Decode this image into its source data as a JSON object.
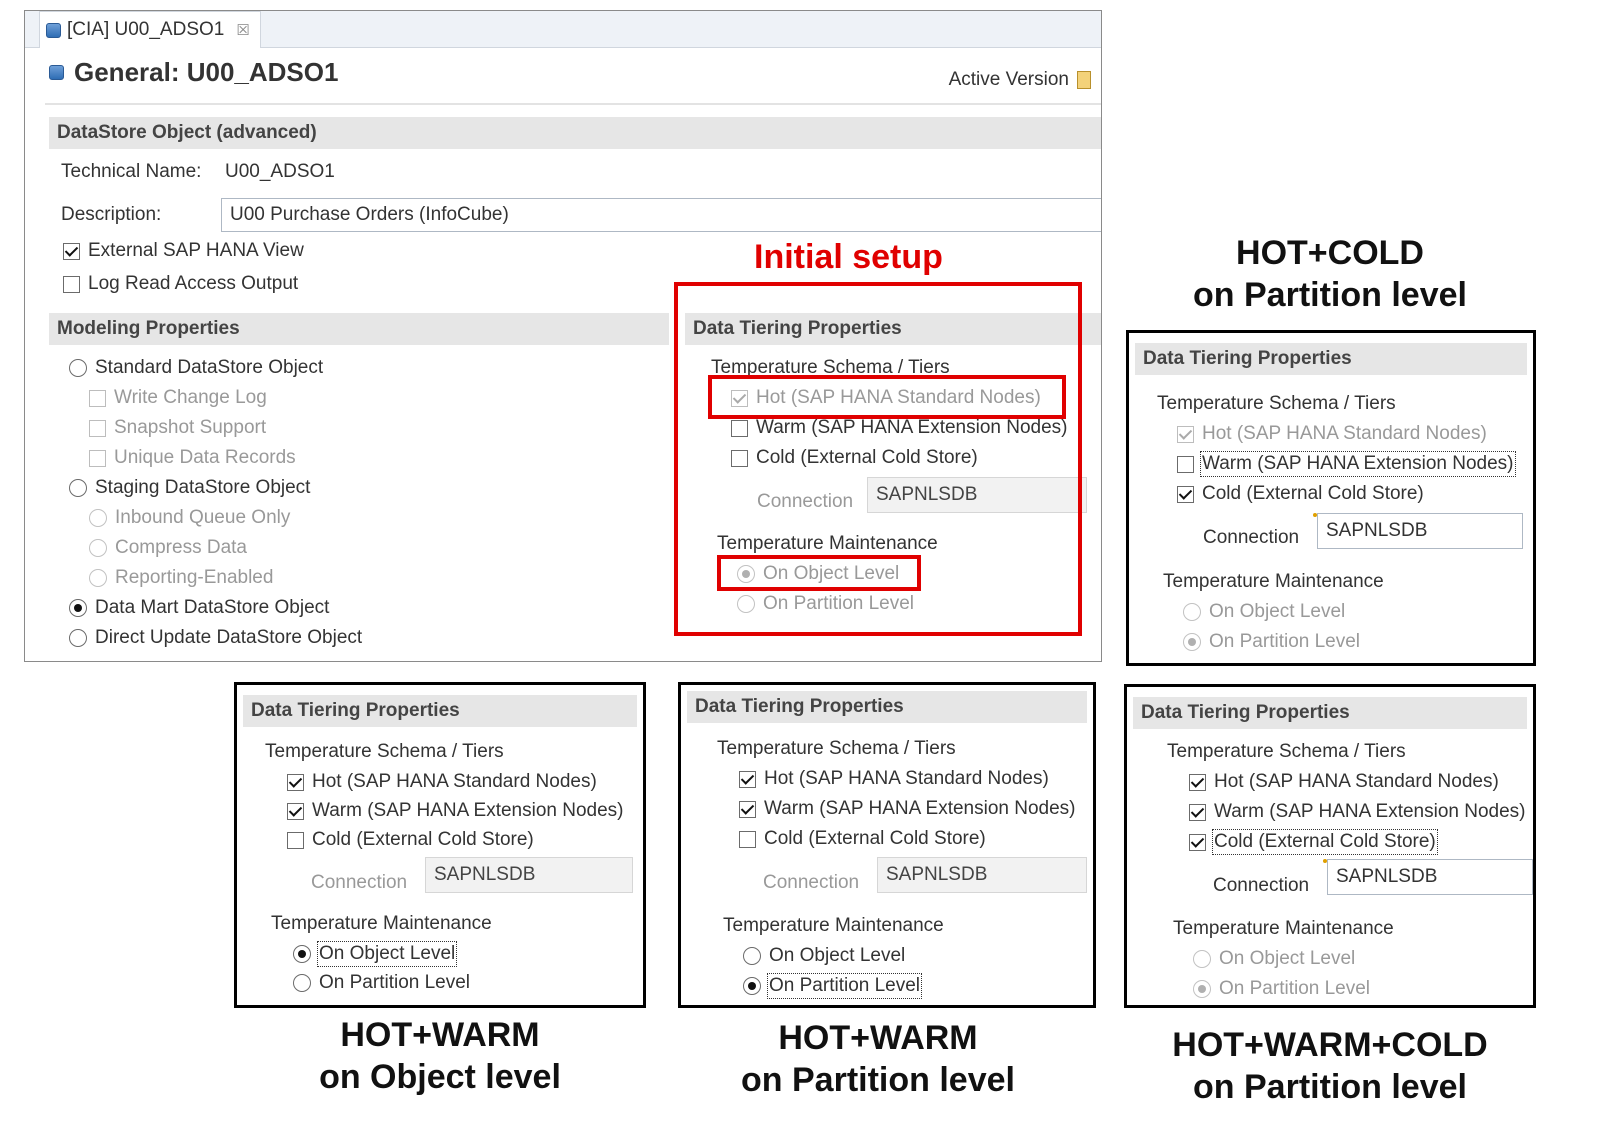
{
  "editor": {
    "tab_label": "[CIA] U00_ADSO1",
    "tab_close": "☒",
    "title": "General: U00_ADSO1",
    "active_version": "Active Version",
    "section_dso": "DataStore Object (advanced)",
    "technical_name_label": "Technical Name:",
    "technical_name_value": "U00_ADSO1",
    "description_label": "Description:",
    "description_value": "U00 Purchase Orders (InfoCube)",
    "external_view": "External SAP HANA View",
    "log_read": "Log Read Access Output",
    "modeling_section": "Modeling Properties",
    "modeling": {
      "standard": "Standard DataStore Object",
      "write_change_log": "Write Change Log",
      "snapshot": "Snapshot Support",
      "unique": "Unique Data Records",
      "staging": "Staging DataStore Object",
      "inbound": "Inbound Queue Only",
      "compress": "Compress Data",
      "reporting": "Reporting-Enabled",
      "data_mart": "Data Mart DataStore Object",
      "direct_update": "Direct Update DataStore Object"
    }
  },
  "tiering_labels": {
    "section": "Data Tiering Properties",
    "schema": "Temperature Schema / Tiers",
    "hot": "Hot (SAP HANA Standard Nodes)",
    "warm": "Warm (SAP HANA Extension Nodes)",
    "cold": "Cold (External Cold Store)",
    "connection": "Connection",
    "connection_value": "SAPNLSDB",
    "maintenance": "Temperature Maintenance",
    "object_level": "On Object Level",
    "partition_level": "On Partition Level"
  },
  "captions": {
    "initial": "Initial  setup",
    "hot_cold": [
      "HOT+COLD",
      "on Partition level"
    ],
    "hot_warm_object": [
      "HOT+WARM",
      "on Object level"
    ],
    "hot_warm_partition": [
      "HOT+WARM",
      "on Partition level"
    ],
    "hot_warm_cold": [
      "HOT+WARM+COLD",
      "on Partition level"
    ]
  },
  "colors": {
    "highlight_red": "#e00000",
    "section_gray": "#e6e6e6",
    "frame_black": "#000000"
  }
}
